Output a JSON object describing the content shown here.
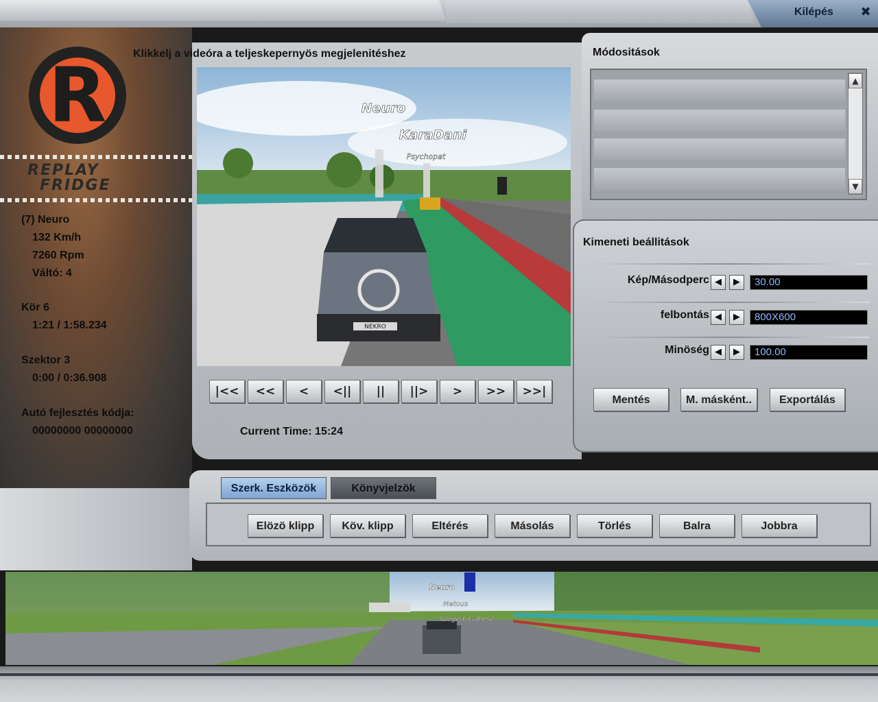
{
  "topbar": {
    "exit_label": "Kilépés",
    "exit_icon": "close-x-icon"
  },
  "logo": {
    "line1": "REPLAY",
    "line2": "FRIDGE",
    "letter": "R",
    "icon": "replay-fridge-logo-icon"
  },
  "stats": {
    "driver": "(7) Neuro",
    "speed": "132 Km/h",
    "rpm": "7260 Rpm",
    "gear": "Váltó: 4",
    "lap_label": "Kör 6",
    "lap_time": "1:21 / 1:58.234",
    "sector_label": "Szektor 3",
    "sector_time": "0:00 / 0:36.908",
    "upgrade_label": "Autó fejlesztés kódja:",
    "upgrade_code": "00000000 00000000"
  },
  "video": {
    "hint": "Klikkelj a videóra a teljeskepernyös megjelenitéshez",
    "name_tags": [
      "Neuro",
      "KaraDani",
      "Psychopat"
    ],
    "plate": "NEKRO"
  },
  "playback": {
    "buttons": [
      {
        "name": "jump-start-button",
        "glyph": "|<<"
      },
      {
        "name": "fast-rewind-button",
        "glyph": "<<"
      },
      {
        "name": "rewind-button",
        "glyph": "<"
      },
      {
        "name": "step-back-button",
        "glyph": "<||"
      },
      {
        "name": "pause-button",
        "glyph": "||"
      },
      {
        "name": "step-forward-button",
        "glyph": "||>"
      },
      {
        "name": "play-button",
        "glyph": ">"
      },
      {
        "name": "fast-forward-button",
        "glyph": ">>"
      },
      {
        "name": "jump-end-button",
        "glyph": ">>|"
      }
    ],
    "current_time": "Current Time: 15:24"
  },
  "mods": {
    "title": "Módositások"
  },
  "output": {
    "title": "Kimeneti beállitások",
    "fps_label": "Kép/Másodperc",
    "fps_value": "30.00",
    "res_label": "felbontás",
    "res_value": "800X600",
    "quality_label": "Minöség",
    "quality_value": "100.00",
    "save": "Mentés",
    "save_as": "M. másként..",
    "export": "Exportálás"
  },
  "tools": {
    "tab_edit": "Szerk. Eszközök",
    "tab_bookmarks": "Könyvjelzök",
    "buttons": [
      "Elözö klipp",
      "Köv. klipp",
      "Eltérés",
      "Másolás",
      "Törlés",
      "Balra",
      "Jobbra"
    ]
  },
  "strip": {
    "name_tags": [
      "Neuro",
      "Matous",
      "Szegedi Gabesz"
    ]
  },
  "colors": {
    "accent_orange": "#e8582c",
    "field_text": "#8fb8ff",
    "tab_active": "#8fb4dd"
  }
}
